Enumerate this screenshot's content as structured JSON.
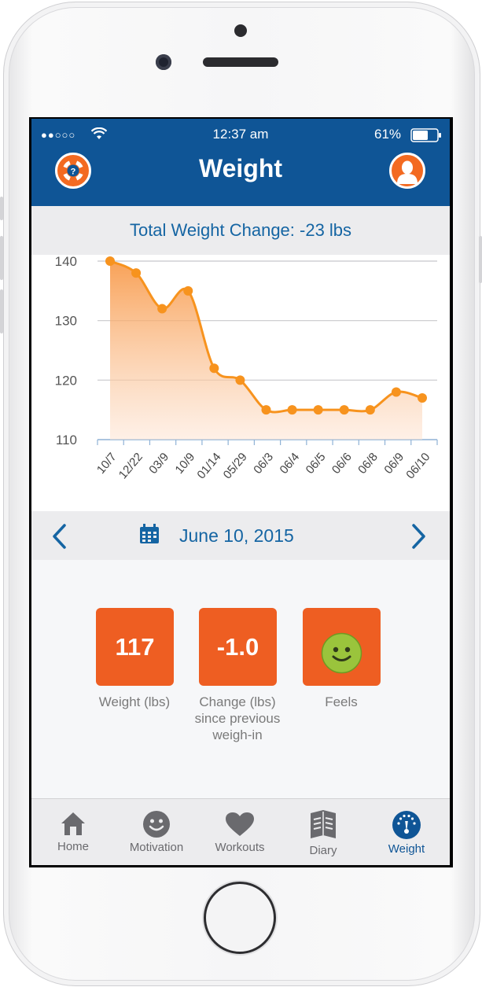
{
  "status_bar": {
    "carrier_signal": "●●○○○",
    "time": "12:37 am",
    "battery": "61%"
  },
  "header": {
    "title": "Weight",
    "help_icon": "lifebuoy-help-icon",
    "profile_icon": "user-avatar-icon",
    "color": "#0f5596"
  },
  "summary": {
    "total_change": "Total Weight Change: -23 lbs"
  },
  "chart_data": {
    "type": "line",
    "categories": [
      "10/7",
      "12/22",
      "03/9",
      "10/9",
      "01/14",
      "05/29",
      "06/3",
      "06/4",
      "06/5",
      "06/6",
      "06/8",
      "06/9",
      "06/10"
    ],
    "values": [
      140,
      138,
      132,
      135,
      122,
      120,
      115,
      115,
      115,
      115,
      115,
      118,
      117
    ],
    "y_ticks": [
      140,
      130,
      120,
      110
    ],
    "ylim": [
      110,
      142
    ],
    "line_color": "#f7931e",
    "fill": "area-gradient",
    "grid": true
  },
  "date_nav": {
    "date": "June 10, 2015",
    "prev_icon": "chevron-left-icon",
    "next_icon": "chevron-right-icon",
    "calendar_icon": "calendar-icon"
  },
  "stats": {
    "weight": {
      "value": "117",
      "label": "Weight (lbs)"
    },
    "change": {
      "value": "-1.0",
      "label_line1": "Change (lbs)",
      "label_line2": "since previous",
      "label_line3": "weigh-in"
    },
    "feels": {
      "icon": "smiley-face-icon",
      "label": "Feels"
    },
    "tile_color": "#ee5e22"
  },
  "tabs": [
    {
      "label": "Home",
      "icon": "home-icon",
      "active": false
    },
    {
      "label": "Motivation",
      "icon": "smiley-icon",
      "active": false
    },
    {
      "label": "Workouts",
      "icon": "heart-icon",
      "active": false
    },
    {
      "label": "Diary",
      "icon": "book-icon",
      "active": false
    },
    {
      "label": "Weight",
      "icon": "scale-gauge-icon",
      "active": true
    }
  ],
  "accent_color": "#1565a3"
}
